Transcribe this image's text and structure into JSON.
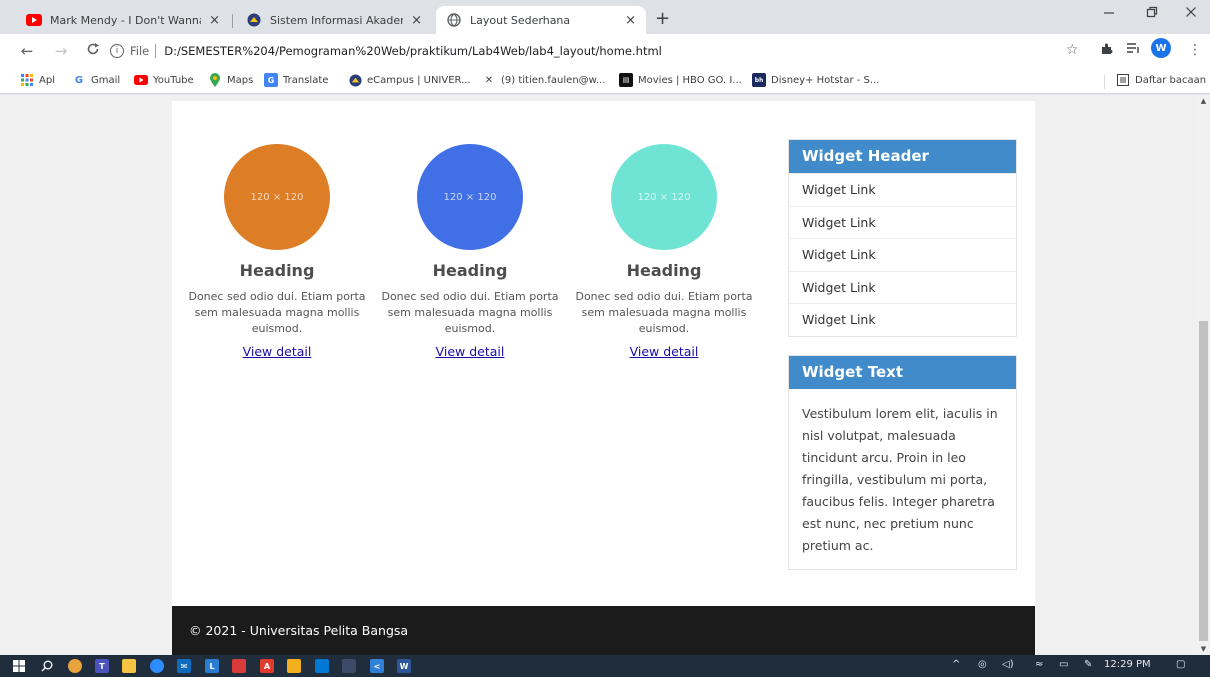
{
  "browser": {
    "tabs": [
      {
        "title": "Mark Mendy - I Don't Wanna Be",
        "icon": "youtube-icon",
        "active": false
      },
      {
        "title": "Sistem Informasi Akademik",
        "icon": "campus-icon",
        "active": false
      },
      {
        "title": "Layout Sederhana",
        "icon": "globe-icon",
        "active": true
      }
    ],
    "tab_close_glyph": "×",
    "new_tab_glyph": "+",
    "address": {
      "scheme_label": "File",
      "url": "D:/SEMESTER%204/Pemograman%20Web/praktikum/Lab4Web/lab4_layout/home.html"
    },
    "profile_initial": "W",
    "bookmarks": [
      {
        "label": "Apl",
        "icon": "apps-grid-icon"
      },
      {
        "label": "Gmail",
        "icon": "google-icon"
      },
      {
        "label": "YouTube",
        "icon": "youtube-icon"
      },
      {
        "label": "Maps",
        "icon": "maps-pin-icon"
      },
      {
        "label": "Translate",
        "icon": "translate-icon"
      },
      {
        "label": "eCampus | UNIVER...",
        "icon": "campus-icon"
      },
      {
        "label": "(9) titien.faulen@w...",
        "icon": "xing-icon"
      },
      {
        "label": "Movies | HBO GO. I...",
        "icon": "hbo-icon"
      },
      {
        "label": "Disney+ Hotstar - S...",
        "icon": "hotstar-icon"
      }
    ],
    "reading_list": "Daftar bacaan"
  },
  "page": {
    "cards": [
      {
        "placeholder": "120 × 120",
        "color": "#dd7d26",
        "heading": "Heading",
        "text": "Donec sed odio dui. Etiam porta sem malesuada magna mollis euismod.",
        "link": "View detail"
      },
      {
        "placeholder": "120 × 120",
        "color": "#4170e6",
        "heading": "Heading",
        "text": "Donec sed odio dui. Etiam porta sem malesuada magna mollis euismod.",
        "link": "View detail"
      },
      {
        "placeholder": "120 × 120",
        "color": "#6fe4d4",
        "heading": "Heading",
        "text": "Donec sed odio dui. Etiam porta sem malesuada magna mollis euismod.",
        "link": "View detail"
      }
    ],
    "widget_links": {
      "header": "Widget Header",
      "links": [
        "Widget Link",
        "Widget Link",
        "Widget Link",
        "Widget Link",
        "Widget Link"
      ]
    },
    "widget_text": {
      "header": "Widget Text",
      "body": "Vestibulum lorem elit, iaculis in nisl volutpat, malesuada tincidunt arcu. Proin in leo fringilla, vestibulum mi porta, faucibus felis. Integer pharetra est nunc, nec pretium nunc pretium ac."
    },
    "footer": "© 2021 - Universitas Pelita Bangsa"
  },
  "taskbar": {
    "clock": "12:29 PM"
  },
  "colors": {
    "widget_header": "#428bca",
    "footer_bg": "#1b1b1b",
    "link": "#1a0dab"
  }
}
